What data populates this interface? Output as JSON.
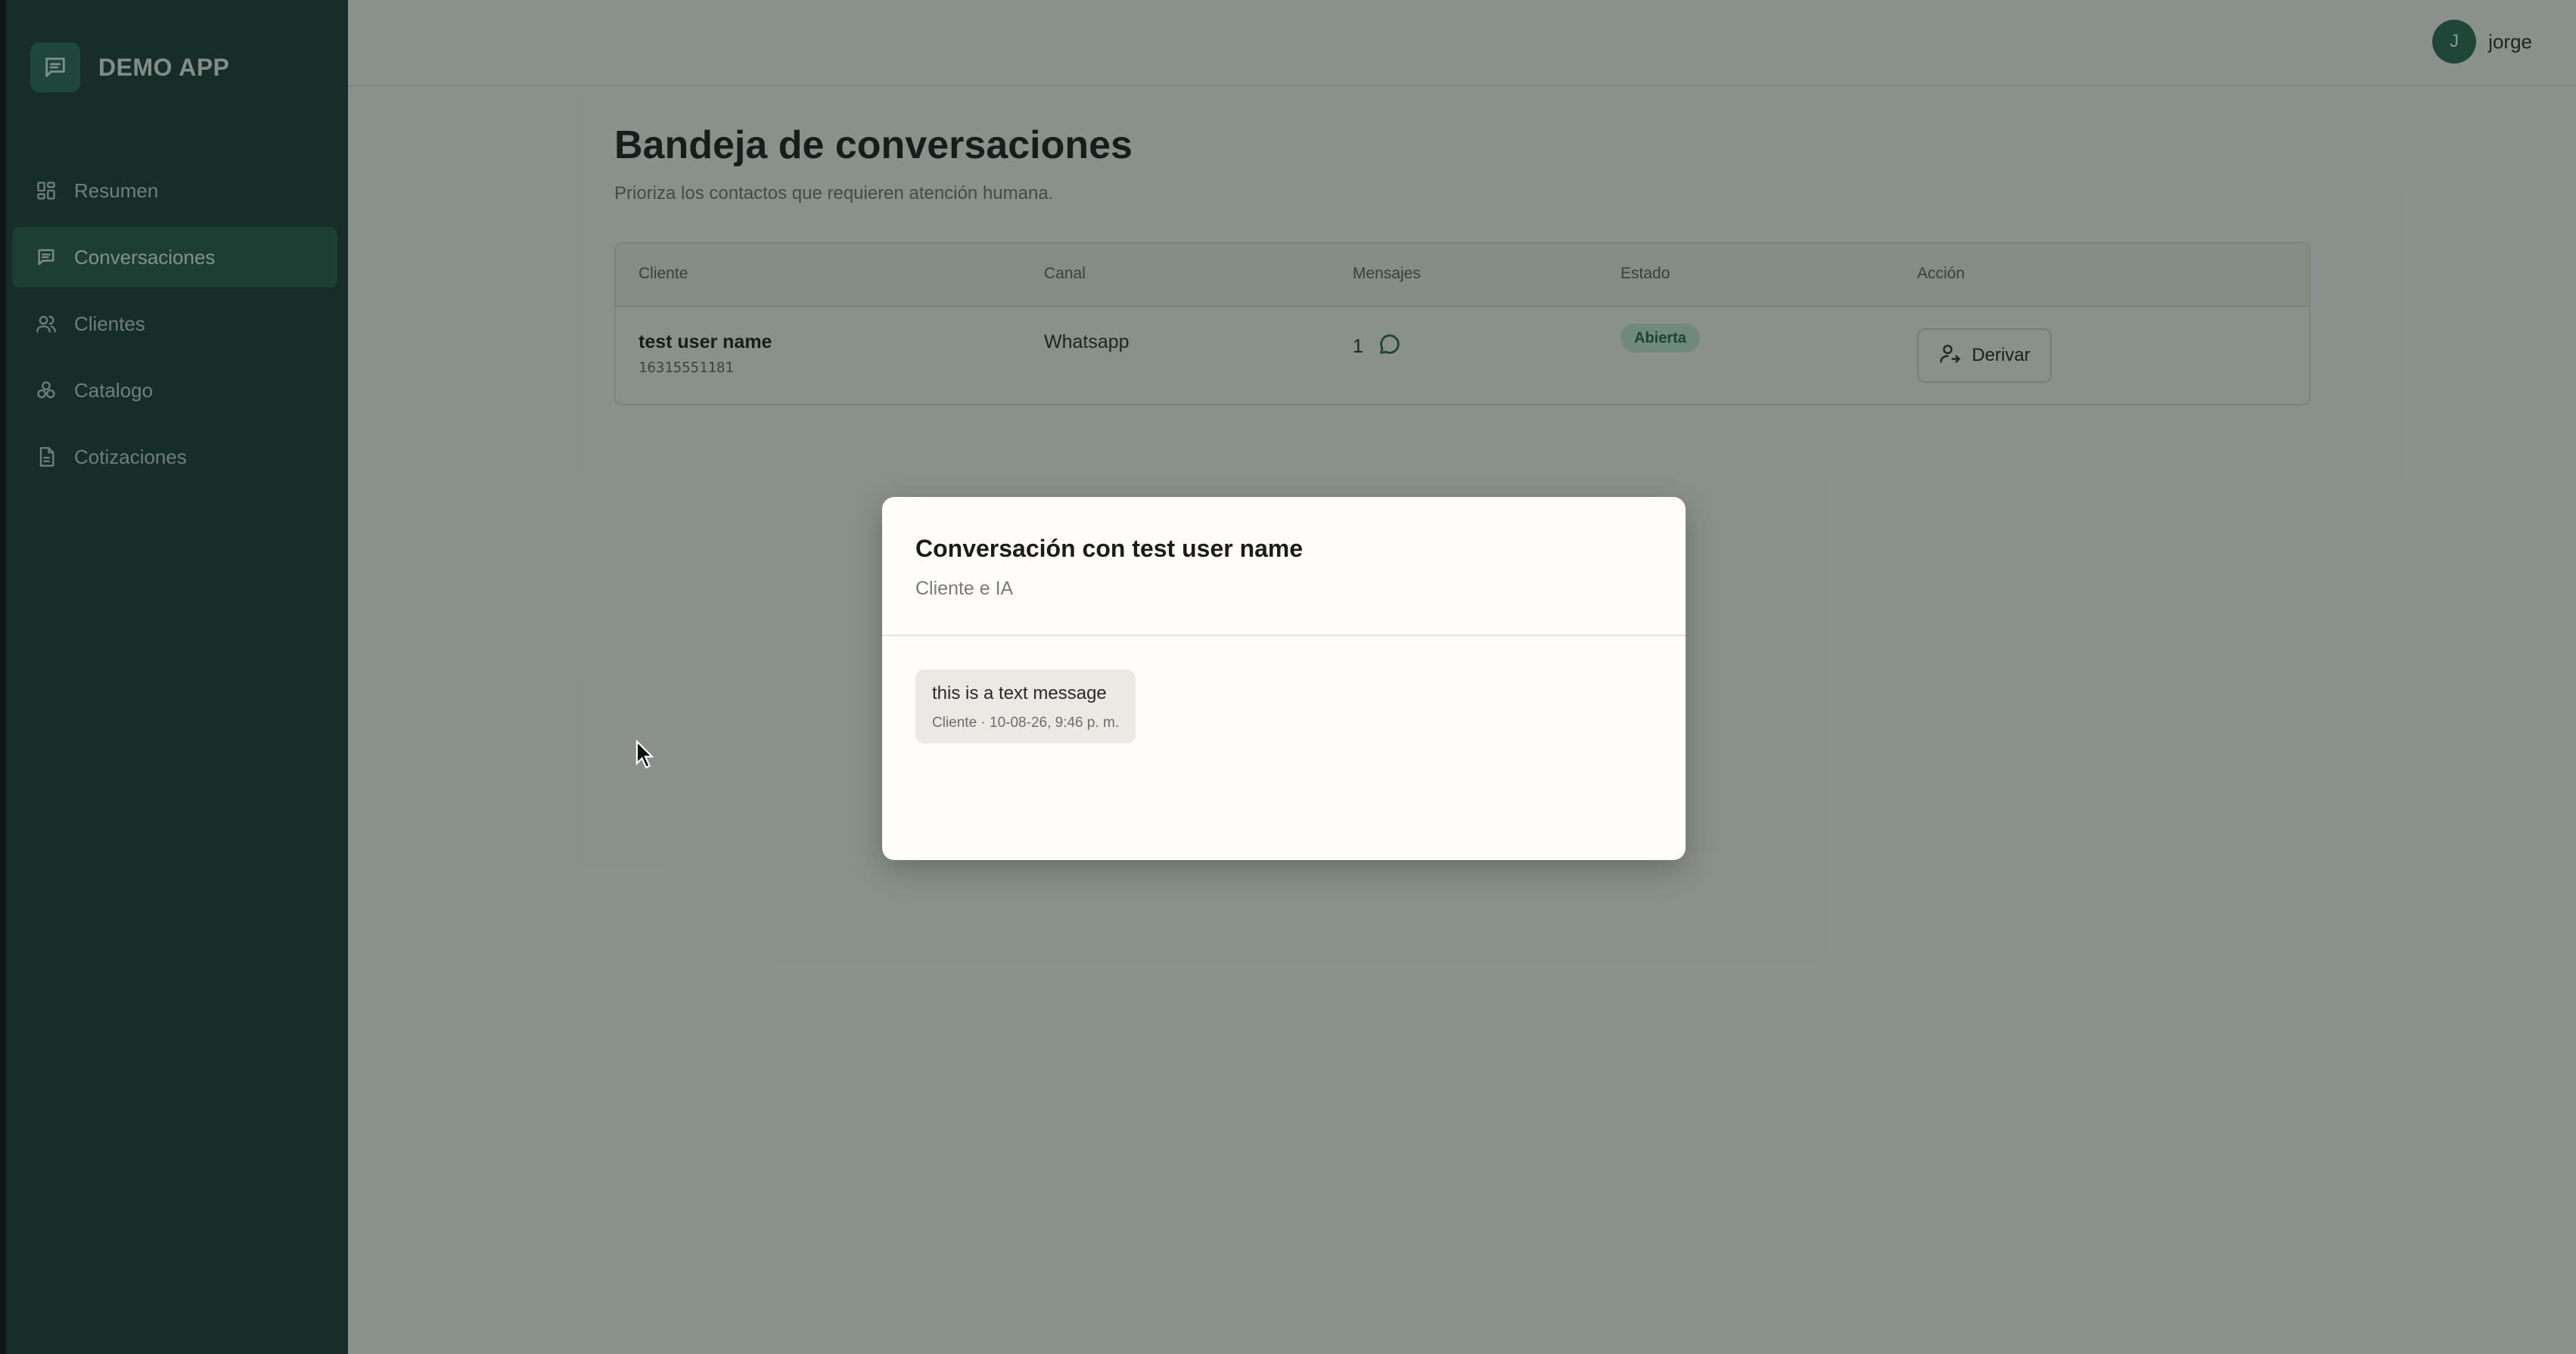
{
  "brand": {
    "name": "DEMO APP",
    "icon": "message-square-icon"
  },
  "sidebar": {
    "items": [
      {
        "label": "Resumen",
        "icon": "dashboard-grid-icon",
        "active": false
      },
      {
        "label": "Conversaciones",
        "icon": "message-square-icon",
        "active": true
      },
      {
        "label": "Clientes",
        "icon": "users-icon",
        "active": false
      },
      {
        "label": "Catalogo",
        "icon": "boxes-icon",
        "active": false
      },
      {
        "label": "Cotizaciones",
        "icon": "file-text-icon",
        "active": false
      }
    ]
  },
  "topbar": {
    "user": {
      "initial": "J",
      "name": "jorge"
    }
  },
  "main": {
    "title": "Bandeja de conversaciones",
    "subtitle": "Prioriza los contactos que requieren atención humana.",
    "table": {
      "headers": [
        "Cliente",
        "Canal",
        "Mensajes",
        "Estado",
        "Acción"
      ],
      "rows": [
        {
          "customer_name": "test user name",
          "customer_phone": "16315551181",
          "channel": "Whatsapp",
          "messages": "1",
          "status": "Abierta",
          "action": "Derivar"
        }
      ]
    }
  },
  "modal": {
    "title": "Conversación con test user name",
    "subtitle": "Cliente e IA",
    "messages": [
      {
        "text": "this is a text message",
        "meta": "Cliente · 10-08-26, 9:46 p. m."
      }
    ]
  },
  "colors": {
    "sidebar_bg": "#1f3a34",
    "sidebar_active": "#2a5a4c",
    "accent": "#2d6b58",
    "badge_bg": "#c7ead9",
    "badge_text": "#256b4d",
    "page_bg": "#fbfaf6"
  }
}
